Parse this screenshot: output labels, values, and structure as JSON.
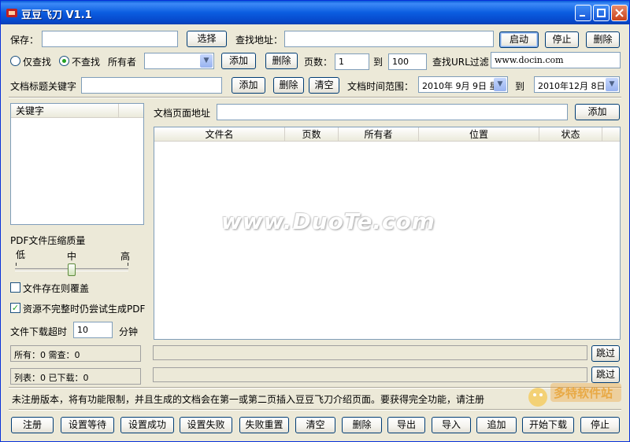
{
  "window": {
    "title": "豆豆飞刀 V1.1"
  },
  "row1": {
    "save_label": "保存：",
    "save_value": "",
    "choose_button": "选择",
    "find_address_label": "查找地址：",
    "find_address_value": "",
    "start_button": "启动",
    "stop_button": "停止",
    "delete_button": "删除"
  },
  "row2": {
    "radio_only_find": "仅查找",
    "radio_no_find": "不查找",
    "owner_label": "所有者",
    "owner_value": "",
    "add_button": "添加",
    "delete_button": "删除",
    "pages_label": "页数：",
    "pages_from": "1",
    "to_label": "到",
    "pages_to": "100",
    "url_filter_label": "查找URL过滤",
    "url_filter_value": "www.docin.com"
  },
  "row3": {
    "title_keyword_label": "文档标题关键字",
    "title_keyword_value": "",
    "add_button": "添加",
    "delete_button": "删除",
    "clear_button": "清空",
    "time_range_label": "文档时间范围：",
    "date_from": "2010年 9月 9日 星",
    "to_label": "到",
    "date_to": "2010年12月 8日"
  },
  "keyword_list": {
    "header": "关键字"
  },
  "page_url": {
    "label": "文档页面地址",
    "value": "",
    "add_button": "添加"
  },
  "file_table": {
    "columns": [
      "文件名",
      "页数",
      "所有者",
      "位置",
      "状态"
    ]
  },
  "pdf_quality": {
    "label": "PDF文件压缩质量",
    "low": "低",
    "mid": "中",
    "high": "高",
    "level": 0.5
  },
  "options": {
    "overwrite_label": "文件存在则覆盖",
    "overwrite_checked": false,
    "try_pdf_label": "资源不完整时仍尝试生成PDF",
    "try_pdf_checked": true,
    "timeout_label": "文件下载超时",
    "timeout_value": "10",
    "timeout_unit": "分钟"
  },
  "status": {
    "total": "所有：0 需查：0",
    "list": "列表：0 已下载：0",
    "skip_button_1": "跳过",
    "skip_button_2": "跳过"
  },
  "notice": "未注册版本，将有功能限制，并且生成的文档会在第一或第二页插入豆豆飞刀介绍页面。要获得完全功能，请注册",
  "bottom_buttons": [
    "注册",
    "设置等待",
    "设置成功",
    "设置失败",
    "失败重置",
    "清空",
    "删除",
    "导出",
    "导入",
    "追加",
    "开始下载",
    "停止"
  ],
  "watermark": "www.DuoTe.com",
  "logo_text": "多特软件站",
  "colors": {
    "title_bar": "#0a5bd8",
    "window_bg": "#ece9d8",
    "border": "#7f9db9"
  }
}
